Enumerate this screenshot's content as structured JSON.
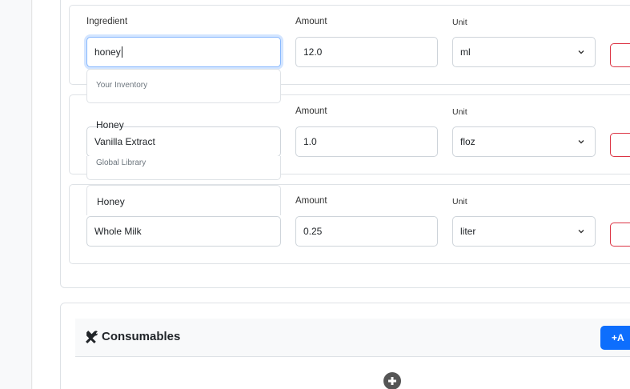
{
  "ingredients": [
    {
      "label_ingredient": "Ingredient",
      "ingredient_value": "honey",
      "label_amount": "Amount",
      "amount": "12.0",
      "label_unit": "Unit",
      "unit": "ml"
    },
    {
      "label_amount": "Amount",
      "ingredient_value": "Vanilla Extract",
      "amount": "1.0",
      "label_unit": "Unit",
      "unit": "floz"
    },
    {
      "label_amount": "Amount",
      "ingredient_value": "Whole Milk",
      "amount": "0.25",
      "label_unit": "Unit",
      "unit": "liter"
    }
  ],
  "dropdown": {
    "inventory_header": "Your Inventory",
    "inventory_items": [
      "Honey"
    ],
    "global_header": "Global Library",
    "global_items": [
      "Honey"
    ]
  },
  "consumables": {
    "title": "Consumables",
    "add_label": "+A"
  },
  "colors": {
    "primary": "#0d6efd",
    "danger": "#dc3545",
    "focus": "#86b7fe"
  }
}
